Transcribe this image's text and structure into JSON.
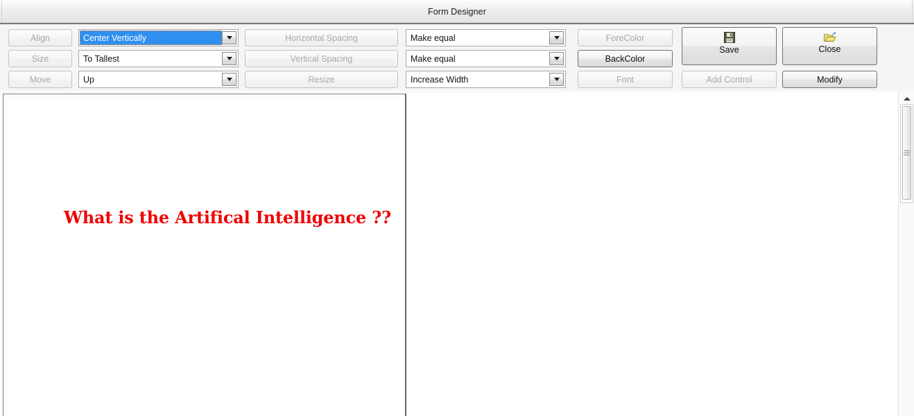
{
  "window": {
    "title": "Form Designer"
  },
  "toolbar": {
    "align_button": {
      "label": "Align",
      "enabled": false
    },
    "size_button": {
      "label": "Size",
      "enabled": false
    },
    "move_button": {
      "label": "Move",
      "enabled": false
    },
    "align_combo": {
      "value": "Center Vertically",
      "selected": true
    },
    "size_combo": {
      "value": "To Tallest",
      "selected": false
    },
    "move_combo": {
      "value": "Up",
      "selected": false
    },
    "horizontal_spacing_button": {
      "label": "Horizontal Spacing",
      "enabled": false
    },
    "vertical_spacing_button": {
      "label": "Vertical Spacing",
      "enabled": false
    },
    "resize_button": {
      "label": "Resize",
      "enabled": false
    },
    "horizontal_spacing_combo": {
      "value": "Make equal"
    },
    "vertical_spacing_combo": {
      "value": "Make equal"
    },
    "resize_combo": {
      "value": "Increase Width"
    },
    "forecolor_button": {
      "label": "ForeColor",
      "enabled": false
    },
    "backcolor_button": {
      "label": "BackColor",
      "enabled": true
    },
    "font_button": {
      "label": "Font",
      "enabled": false
    },
    "save_button": {
      "label": "Save",
      "icon": "floppy-disk-icon",
      "enabled": true
    },
    "close_button": {
      "label": "Close",
      "icon": "open-folder-icon",
      "enabled": true
    },
    "add_control_button": {
      "label": "Add Control",
      "enabled": false
    },
    "modify_button": {
      "label": "Modify",
      "enabled": true
    }
  },
  "canvas": {
    "form_label": "What is the Artifical Intelligence ??",
    "label_color": "#ee0000"
  },
  "scrollbar": {
    "up_arrow": "scroll-up-icon"
  },
  "colors": {
    "highlight": "#2f8fee",
    "label_red": "#ee0000",
    "toolbar_bg": "#f5f5f5",
    "folder_yellow": "#e8d44a"
  }
}
